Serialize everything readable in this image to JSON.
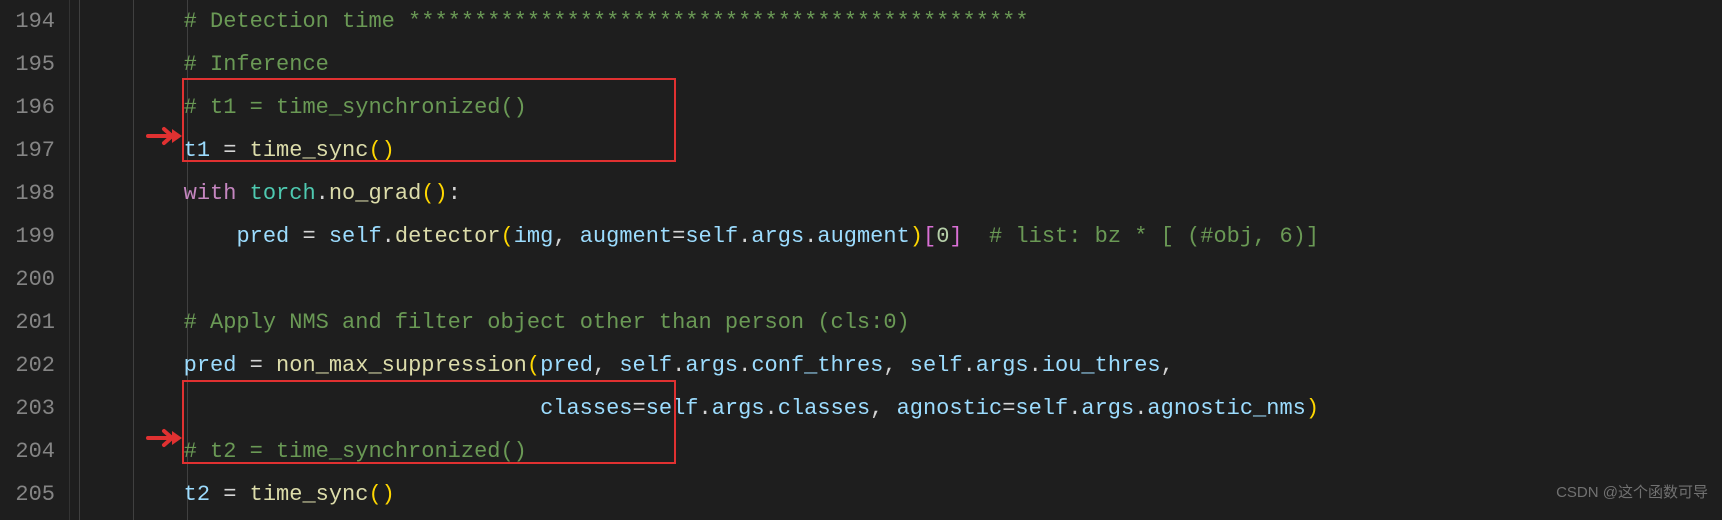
{
  "gutter": {
    "start": 194,
    "lines": [
      "194",
      "195",
      "196",
      "197",
      "198",
      "199",
      "200",
      "201",
      "202",
      "203",
      "204",
      "205"
    ]
  },
  "code": {
    "l194": {
      "indent": "        ",
      "comment": "# Detection time ***********************************************"
    },
    "l195": {
      "indent": "        ",
      "comment": "# Inference"
    },
    "l196": {
      "indent": "        ",
      "comment": "# t1 = time_synchronized()"
    },
    "l197": {
      "indent": "        ",
      "var": "t1",
      "op": " = ",
      "func": "time_sync",
      "paren": "()"
    },
    "l198": {
      "indent": "        ",
      "kw": "with",
      "sp": " ",
      "mod": "torch",
      "dot": ".",
      "func": "no_grad",
      "paren": "()",
      "colon": ":"
    },
    "l199": {
      "indent": "            ",
      "var": "pred",
      "op": " = ",
      "self": "self",
      "dot1": ".",
      "func": "detector",
      "op2": "(",
      "arg1": "img",
      "comma": ", ",
      "arg2": "augment",
      "eq": "=",
      "self2": "self",
      "dot2": ".",
      "attr": "args",
      "dot3": ".",
      "attr2": "augment",
      "close": ")",
      "idx": "[",
      "num": "0",
      "idx2": "]",
      "sp": "  ",
      "comment": "# list: bz * [ (#obj, 6)]"
    },
    "l200": {
      "indent": ""
    },
    "l201": {
      "indent": "        ",
      "comment": "# Apply NMS and filter object other than person (cls:0)"
    },
    "l202": {
      "indent": "        ",
      "var": "pred",
      "op": " = ",
      "func": "non_max_suppression",
      "op2": "(",
      "a1": "pred",
      "c1": ", ",
      "s1": "self",
      "d1": ".",
      "at1": "args",
      "d2": ".",
      "at2": "conf_thres",
      "c2": ", ",
      "s2": "self",
      "d3": ".",
      "at3": "args",
      "d4": ".",
      "at4": "iou_thres",
      "c3": ","
    },
    "l203": {
      "indent": "                                   ",
      "a1": "classes",
      "eq1": "=",
      "s1": "self",
      "d1": ".",
      "at1": "args",
      "d2": ".",
      "at2": "classes",
      "c1": ", ",
      "a2": "agnostic",
      "eq2": "=",
      "s2": "self",
      "d3": ".",
      "at3": "args",
      "d4": ".",
      "at4": "agnostic_nms",
      "close": ")"
    },
    "l204": {
      "indent": "        ",
      "comment": "# t2 = time_synchronized()"
    },
    "l205": {
      "indent": "        ",
      "var": "t2",
      "op": " = ",
      "func": "time_sync",
      "paren": "()"
    }
  },
  "watermark": "CSDN @这个函数可导"
}
